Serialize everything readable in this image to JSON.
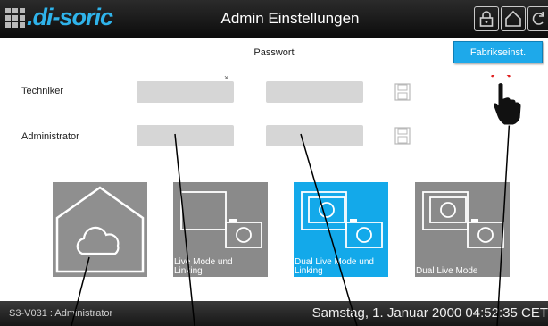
{
  "header": {
    "logo_text": ".di-soric",
    "title": "Admin Einstellungen",
    "buttons": [
      "lock-icon",
      "home-icon",
      "back-icon"
    ]
  },
  "password": {
    "section_title": "Passwort",
    "clear_symbol": "×",
    "rows": [
      {
        "label": "Techniker"
      },
      {
        "label": "Administrator"
      }
    ]
  },
  "factory_button": {
    "label": "Fabrikseinst."
  },
  "tiles": [
    {
      "label": "",
      "icon": "cloud-home-icon"
    },
    {
      "label": "Live Mode und Linking",
      "icon": "camera-icon"
    },
    {
      "label": "Dual Live Mode und Linking",
      "icon": "dual-camera-icon"
    },
    {
      "label": "Dual Live Mode",
      "icon": "dual-camera-icon"
    }
  ],
  "status": {
    "left": "S3-V031 : Administrator",
    "right": "Samstag, 1. Januar 2000 04:52:35 CET"
  },
  "colors": {
    "accent": "#13a9ea",
    "logo": "#2fb3ea",
    "tile": "#8a8a8a",
    "field": "#d6d6d6"
  }
}
